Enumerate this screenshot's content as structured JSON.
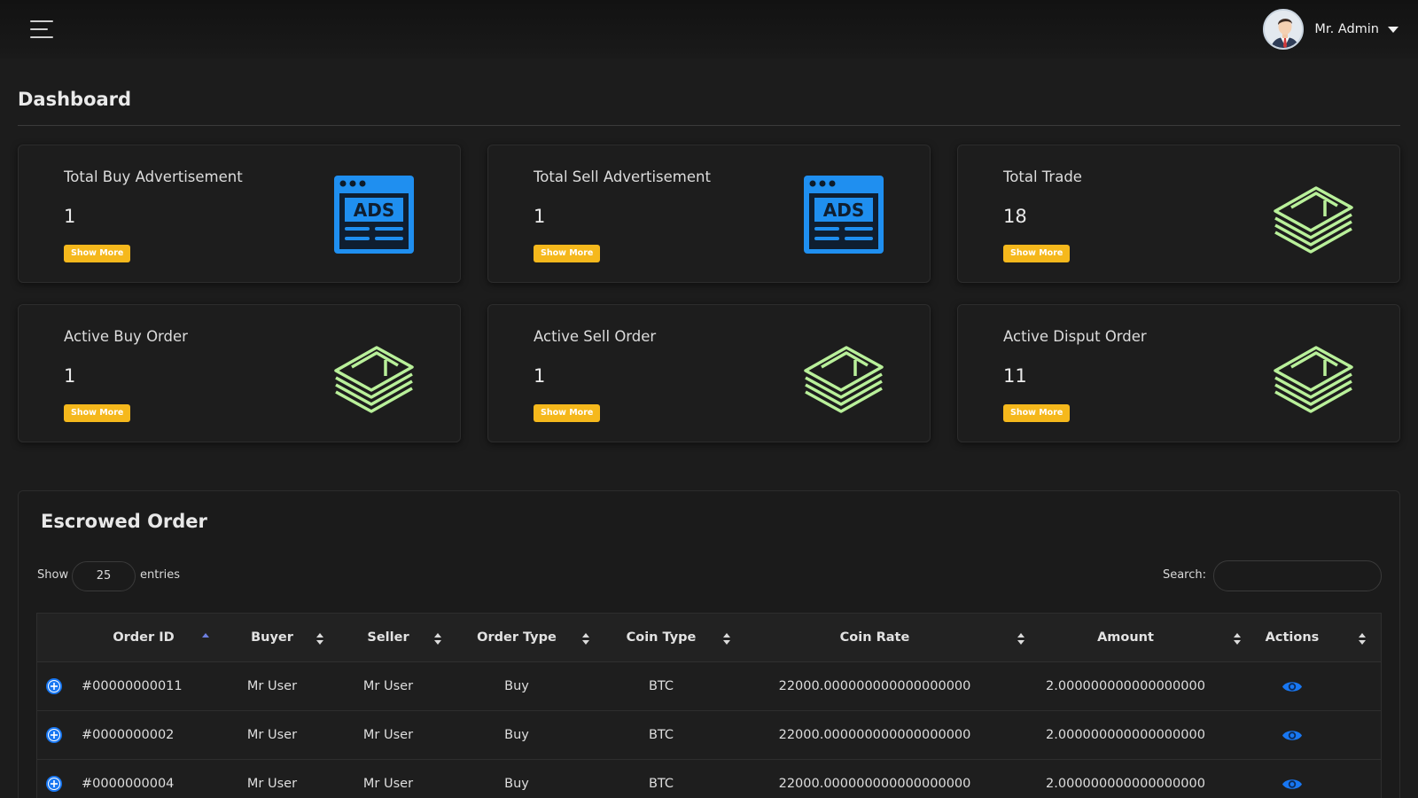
{
  "header": {
    "user_name": "Mr. Admin",
    "icons": {
      "menu": "hamburger-menu-icon",
      "avatar": "user-avatar",
      "dropdown": "caret-down-icon"
    }
  },
  "page": {
    "title": "Dashboard"
  },
  "colors": {
    "background": "#1c1c1c",
    "card": "#1d1d1d",
    "accent_button": "#f5b81c",
    "ads_icon": "#1f8ff0",
    "money_icon": "#b9f09a",
    "action_icon": "#1877f2",
    "sort_active": "#6d7fe0"
  },
  "cards": [
    {
      "label": "Total Buy Advertisement",
      "value": "1",
      "button": "Show More",
      "icon": "ads-icon"
    },
    {
      "label": "Total Sell Advertisement",
      "value": "1",
      "button": "Show More",
      "icon": "ads-icon"
    },
    {
      "label": "Total Trade",
      "value": "18",
      "button": "Show More",
      "icon": "money-stack-icon"
    },
    {
      "label": "Active Buy Order",
      "value": "1",
      "button": "Show More",
      "icon": "money-stack-icon"
    },
    {
      "label": "Active Sell Order",
      "value": "1",
      "button": "Show More",
      "icon": "money-stack-icon"
    },
    {
      "label": "Active Disput Order",
      "value": "11",
      "button": "Show More",
      "icon": "money-stack-icon"
    }
  ],
  "escrow": {
    "title": "Escrowed Order",
    "length": {
      "prefix": "Show",
      "value": "25",
      "suffix": "entries"
    },
    "search": {
      "label": "Search:",
      "value": ""
    },
    "columns": [
      "Order ID",
      "Buyer",
      "Seller",
      "Order Type",
      "Coin Type",
      "Coin Rate",
      "Amount",
      "Actions"
    ],
    "sorted_column": "Order ID",
    "sort_direction": "ascending",
    "rows": [
      {
        "order_id": "#00000000011",
        "buyer": "Mr User",
        "seller": "Mr User",
        "order_type": "Buy",
        "coin_type": "BTC",
        "coin_rate": "22000.000000000000000000",
        "amount": "2.000000000000000000"
      },
      {
        "order_id": "#0000000002",
        "buyer": "Mr User",
        "seller": "Mr User",
        "order_type": "Buy",
        "coin_type": "BTC",
        "coin_rate": "22000.000000000000000000",
        "amount": "2.000000000000000000"
      },
      {
        "order_id": "#0000000004",
        "buyer": "Mr User",
        "seller": "Mr User",
        "order_type": "Buy",
        "coin_type": "BTC",
        "coin_rate": "22000.000000000000000000",
        "amount": "2.000000000000000000"
      }
    ],
    "row_icons": {
      "expand": "plus-circle-icon",
      "view": "eye-icon"
    }
  }
}
